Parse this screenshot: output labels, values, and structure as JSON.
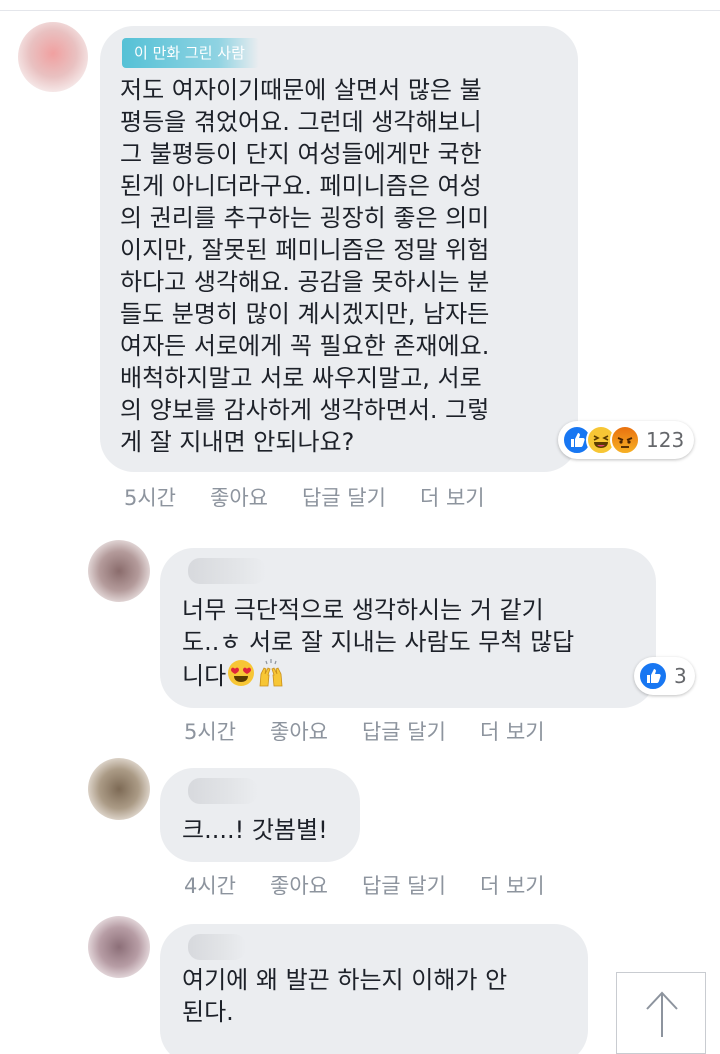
{
  "main_comment": {
    "author_badge": "이 만화 그린 사람",
    "text": "저도 여자이기때문에 살면서 많은 불\n평등을 겪었어요. 그런데 생각해보니\n그 불평등이 단지 여성들에게만 국한\n된게 아니더라구요. 페미니즘은 여성\n의 권리를 추구하는 굉장히 좋은 의미\n이지만, 잘못된 페미니즘은 정말 위험\n하다고 생각해요. 공감을 못하시는 분\n들도 분명히 많이 계시겠지만, 남자든\n여자든 서로에게 꼭 필요한 존재에요.\n배척하지말고 서로 싸우지말고, 서로\n의 양보를 감사하게 생각하면서. 그렇\n게 잘 지내면 안되나요?",
    "reaction_count": "123",
    "reactions": [
      "like-icon",
      "haha-icon",
      "angry-icon"
    ],
    "time": "5시간",
    "like_label": "좋아요",
    "reply_label": "답글 달기",
    "more_label": "더 보기"
  },
  "replies": [
    {
      "text_line1": "너무 극단적으로 생각하시는 거 같기",
      "text_line2": "도..ㅎ 서로 잘 지내는 사람도 무척 많답",
      "text_line3": "니다",
      "emojis": [
        "heart-eyes-emoji",
        "raising-hands-emoji"
      ],
      "reaction_count": "3",
      "time": "5시간",
      "like_label": "좋아요",
      "reply_label": "답글 달기",
      "more_label": "더 보기"
    },
    {
      "text": "크....! 갓봄별!",
      "time": "4시간",
      "like_label": "좋아요",
      "reply_label": "답글 달기",
      "more_label": "더 보기"
    },
    {
      "text": "여기에 왜 발끈 하는지 이해가 안\n된다."
    }
  ],
  "scroll_top_icon": "arrow-up-icon",
  "colors": {
    "bubble_bg": "#ebedf0",
    "like_blue": "#1877f2",
    "meta_gray": "#8d949e",
    "badge_teal": "#55c1d6"
  }
}
